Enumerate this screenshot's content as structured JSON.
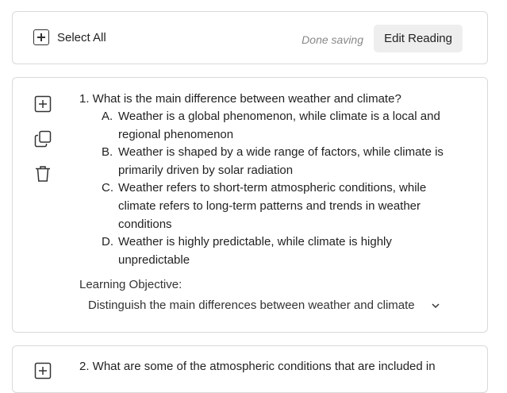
{
  "toolbar": {
    "select_all_label": "Select All",
    "status_text": "Done saving",
    "edit_button_label": "Edit Reading"
  },
  "questions": [
    {
      "title": "1. What is the main difference between weather and climate?",
      "options": [
        {
          "letter": "A.",
          "text": "Weather is a global phenomenon, while climate is a local and regional phenomenon"
        },
        {
          "letter": "B.",
          "text": "Weather is shaped by a wide range of factors, while climate is primarily driven by solar radiation"
        },
        {
          "letter": "C.",
          "text": "Weather refers to short-term atmospheric conditions, while climate refers to long-term patterns and trends in weather conditions"
        },
        {
          "letter": "D.",
          "text": "Weather is highly predictable, while climate is highly unpredictable"
        }
      ],
      "learning_objective_label": "Learning Objective:",
      "learning_objective_value": "Distinguish the main differences between weather and climate"
    },
    {
      "title": "2. What are some of the atmospheric conditions that are included in"
    }
  ],
  "icons": {
    "add": "plus-box-icon",
    "copy": "copy-icon",
    "delete": "trash-icon",
    "dropdown": "chevron-down-icon"
  }
}
